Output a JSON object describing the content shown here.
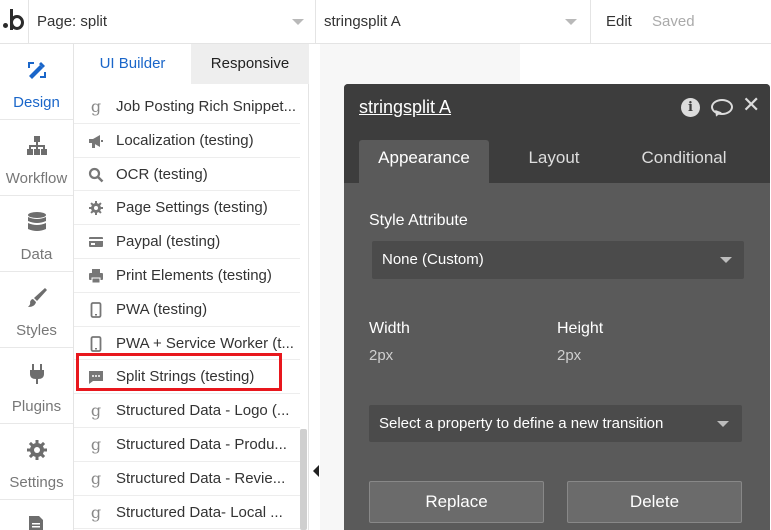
{
  "topbar": {
    "page_select": "Page: split",
    "element_select": "stringsplit A",
    "edit_label": "Edit",
    "saved_label": "Saved"
  },
  "leftnav": {
    "items": [
      {
        "label": "Design",
        "icon": "design-icon",
        "active": true
      },
      {
        "label": "Workflow",
        "icon": "workflow-icon"
      },
      {
        "label": "Data",
        "icon": "database-icon"
      },
      {
        "label": "Styles",
        "icon": "brush-icon"
      },
      {
        "label": "Plugins",
        "icon": "plug-icon"
      },
      {
        "label": "Settings",
        "icon": "gear-icon"
      }
    ]
  },
  "panel": {
    "tabs": [
      "UI Builder",
      "Responsive"
    ],
    "items": [
      {
        "label": "Job Posting Rich Snippet...",
        "icon": "g"
      },
      {
        "label": "Localization (testing)",
        "icon": "megaphone-icon"
      },
      {
        "label": "OCR (testing)",
        "icon": "search-icon"
      },
      {
        "label": "Page Settings (testing)",
        "icon": "gear-icon"
      },
      {
        "label": "Paypal (testing)",
        "icon": "credit-card-icon"
      },
      {
        "label": "Print Elements (testing)",
        "icon": "printer-icon"
      },
      {
        "label": "PWA (testing)",
        "icon": "phone-icon"
      },
      {
        "label": "PWA + Service Worker (t...",
        "icon": "phone-icon"
      },
      {
        "label": "Split Strings (testing)",
        "icon": "comment-icon",
        "highlighted": true
      },
      {
        "label": "Structured Data - Logo (...",
        "icon": "g"
      },
      {
        "label": "Structured Data - Produ...",
        "icon": "g"
      },
      {
        "label": "Structured Data - Revie...",
        "icon": "g"
      },
      {
        "label": "Structured Data- Local ...",
        "icon": "g"
      }
    ]
  },
  "editor": {
    "title": "stringsplit A",
    "tabs": [
      "Appearance",
      "Layout",
      "Conditional"
    ],
    "active_tab": "Appearance",
    "style_attribute_label": "Style Attribute",
    "style_attribute_value": "None (Custom)",
    "width_label": "Width",
    "height_label": "Height",
    "width_value": "2px",
    "height_value": "2px",
    "transition_placeholder": "Select a property to define a new transition",
    "replace_label": "Replace",
    "delete_label": "Delete"
  },
  "colors": {
    "accent": "#1a66c9",
    "highlight_box": "#e8171d",
    "editor_bg": "#5a5a5a",
    "editor_header": "#3d3d3d"
  }
}
